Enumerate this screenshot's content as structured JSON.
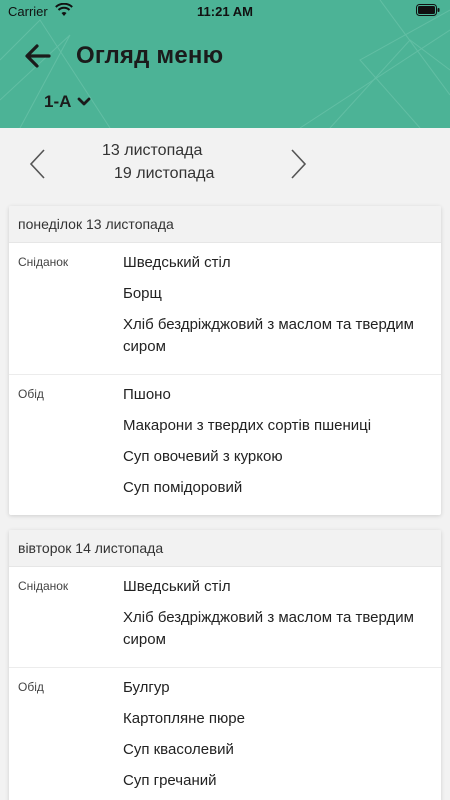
{
  "status_bar": {
    "carrier": "Carrier",
    "time": "11:21 AM"
  },
  "header": {
    "title": "Огляд меню",
    "class_label": "1-A"
  },
  "week": {
    "start": "13 листопада",
    "end": "19 листопада"
  },
  "days": [
    {
      "label": "понеділок 13 листопада",
      "meals": [
        {
          "name": "Сніданок",
          "dishes": [
            "Шведський стіл",
            "Борщ",
            "Хліб бездріжджовий з маслом та твердим сиром"
          ]
        },
        {
          "name": "Обід",
          "dishes": [
            "Пшоно",
            "Макарони з твердих сортів пшениці",
            "Суп овочевий з куркою",
            "Суп помідоровий"
          ]
        }
      ]
    },
    {
      "label": "вівторок 14 листопада",
      "meals": [
        {
          "name": "Сніданок",
          "dishes": [
            "Шведський стіл",
            "Хліб бездріжджовий з маслом та твердим сиром"
          ]
        },
        {
          "name": "Обід",
          "dishes": [
            "Булгур",
            "Картопляне пюре",
            "Суп квасолевий",
            "Суп гречаний"
          ]
        }
      ]
    }
  ],
  "colors": {
    "header": "#4cb396",
    "background": "#f2f2f2"
  }
}
